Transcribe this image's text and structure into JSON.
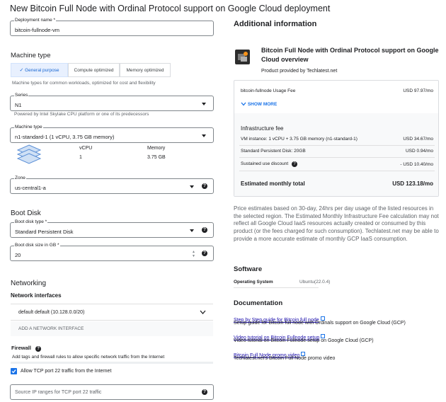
{
  "page": {
    "title": "New Bitcoin Full Node with Ordinal Protocol support on Google Cloud deployment"
  },
  "deployment": {
    "label": "Deployment name *",
    "value": "bitcoin-fullnode-vm"
  },
  "machine_type": {
    "heading": "Machine type",
    "tabs": [
      "General purpose",
      "Compute optimized",
      "Memory optimized"
    ],
    "selected_tab": 0,
    "description": "Machine types for common workloads, optimized for cost and flexibility",
    "series": {
      "label": "Series",
      "value": "N1",
      "hint": "Powered by Intel Skylake CPU platform or one of its predecessors"
    },
    "machine": {
      "label": "Machine type",
      "value": "n1-standard-1 (1 vCPU, 3.75 GB memory)"
    },
    "vcpu_label": "vCPU",
    "vcpu_value": "1",
    "memory_label": "Memory",
    "memory_value": "3.75 GB",
    "zone": {
      "label": "Zone",
      "value": "us-central1-a"
    }
  },
  "boot_disk": {
    "heading": "Boot Disk",
    "type_label": "Boot disk type *",
    "type_value": "Standard Persistent Disk",
    "size_label": "Boot disk size in GB *",
    "size_value": "20"
  },
  "networking": {
    "heading": "Networking",
    "interfaces_heading": "Network interfaces",
    "interface": "default default (10.128.0.0/20)",
    "add_interface": "ADD A NETWORK INTERFACE",
    "firewall_heading": "Firewall",
    "firewall_desc": "Add tags and firewall rules to allow specific network traffic from the Internet",
    "allow_tcp22_label": "Allow TCP port 22 traffic from the Internet",
    "allow_tcp22_checked": true,
    "source_ip_placeholder": "Source IP ranges for TCP port 22 traffic"
  },
  "additional": {
    "heading": "Additional information",
    "product_title": "Bitcoin Full Node with Ordinal Protocol support on Google Cloud overview",
    "provider": "Product provided by Techlatest.net",
    "usage_fee_label": "bitcoin-fullnode Usage Fee",
    "usage_fee_value": "USD 97.97/mo",
    "show_more": "SHOW MORE",
    "infra_heading": "Infrastructure fee",
    "rows": [
      {
        "label": "VM instance: 1 vCPU + 3.75 GB memory (n1-standard-1)",
        "value": "USD 34.67/mo"
      },
      {
        "label": "Standard Persistent Disk: 20GB",
        "value": "USD 0.94/mo"
      },
      {
        "label": "Sustained use discount",
        "value": "- USD 10.40/mo"
      }
    ],
    "total_label": "Estimated monthly total",
    "total_value": "USD 123.18/mo",
    "disclaimer": "Price estimates based on 30-day, 24hrs per day usage of the listed resources in the selected region. The Estimated Monthly Infrastructure Fee calculation may not reflect all Google Cloud IaaS resources actually created or consumed by this product (or the fees charged for such consumption). Techlatest.net may be able to provide a more accurate estimate of monthly GCP IaaS consumption.",
    "software_heading": "Software",
    "os_label": "Operating System",
    "os_value": "Ubuntu(22.0.4)",
    "docs_heading": "Documentation",
    "docs": [
      {
        "link": "Step by Step guide for Bitcoin full node",
        "desc": "Setup guide for Bitcoin full node with Ordinals support on Google Cloud (GCP)"
      },
      {
        "link": "Video tutorial on Bitcoin Fullnode setup",
        "desc": "Video tutorial on Bitcoin Fullnode setup on Google Cloud (GCP)"
      },
      {
        "link": "Bitcoin Full Node promo video",
        "desc": "Techlatest.net's Bitcoin Full Node promo video"
      }
    ]
  },
  "colors": {
    "accent": "#1a73e8",
    "link": "#1a0dab",
    "active_tab_bg": "#e8f0fe"
  }
}
